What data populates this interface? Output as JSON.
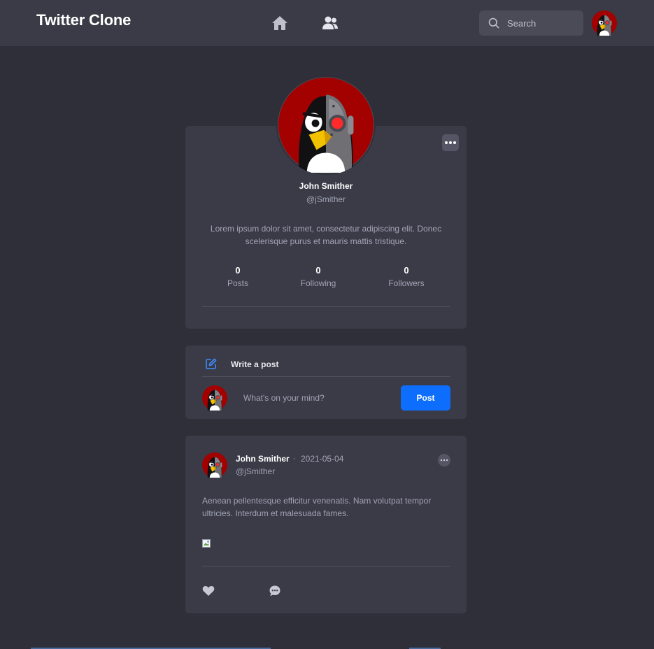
{
  "header": {
    "brand": "Twitter Clone",
    "nav": [
      {
        "name": "home",
        "icon": "home-icon"
      },
      {
        "name": "users",
        "icon": "users-icon"
      }
    ],
    "search": {
      "placeholder": "Search",
      "icon": "search-icon"
    },
    "avatar_icon": "penguin-avatar"
  },
  "profile": {
    "name": "John Smither",
    "handle": "@jSmither",
    "bio": "Lorem ipsum dolor sit amet, consectetur adipiscing elit. Donec scelerisque purus et mauris mattis tristique.",
    "stats": [
      {
        "value": "0",
        "label": "Posts"
      },
      {
        "value": "0",
        "label": "Following"
      },
      {
        "value": "0",
        "label": "Followers"
      }
    ]
  },
  "compose": {
    "title": "Write a post",
    "placeholder": "What's on your mind?",
    "button": "Post"
  },
  "post": {
    "author": "John Smither",
    "separator": "·",
    "date": "2021-05-04",
    "handle": "@jSmither",
    "text": "Aenean pellentesque efficitur venenatis. Nam volutpat tempor ultricies. Interdum et malesuada fames.",
    "actions": [
      {
        "name": "like",
        "icon": "heart-icon"
      },
      {
        "name": "comment",
        "icon": "comment-icon"
      }
    ]
  },
  "colors": {
    "background": "#2e2f39",
    "surface": "#3a3b47",
    "accent": "#0d6efd",
    "muted_text": "#a3a4b5"
  }
}
